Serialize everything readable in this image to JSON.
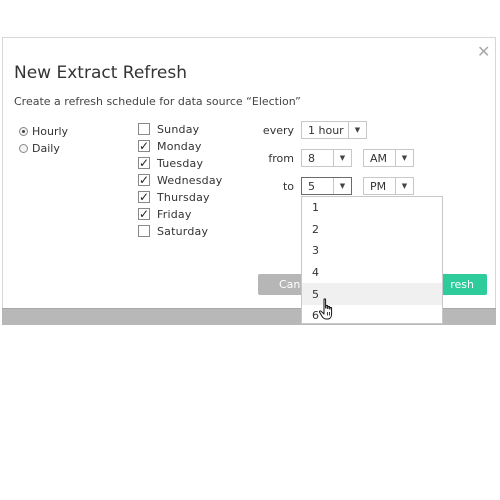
{
  "dialog": {
    "title": "New Extract Refresh",
    "subtitle": "Create a refresh schedule for data source “Election”",
    "close_icon": "✕"
  },
  "frequency": {
    "options": [
      {
        "label": "Hourly",
        "checked": true
      },
      {
        "label": "Daily",
        "checked": false
      }
    ]
  },
  "days": [
    {
      "label": "Sunday",
      "checked": false
    },
    {
      "label": "Monday",
      "checked": true
    },
    {
      "label": "Tuesday",
      "checked": true
    },
    {
      "label": "Wednesday",
      "checked": true
    },
    {
      "label": "Thursday",
      "checked": true
    },
    {
      "label": "Friday",
      "checked": true
    },
    {
      "label": "Saturday",
      "checked": false
    }
  ],
  "schedule": {
    "every_label": "every",
    "every_value": "1 hour",
    "from_label": "from",
    "from_hour": "8",
    "from_ampm": "AM",
    "to_label": "to",
    "to_hour": "5",
    "to_ampm": "PM"
  },
  "dropdown": {
    "items": [
      "1",
      "2",
      "3",
      "4",
      "5",
      "6"
    ],
    "hovered_item": "5"
  },
  "buttons": {
    "cancel_label": "Can",
    "submit_label": "resh"
  },
  "icons": {
    "check": "✓",
    "dropdown_arrow": "▼",
    "cursor": "hand-pointer-icon"
  },
  "colors": {
    "submit_button": "#2ecc9a",
    "cancel_button": "#b6b6b6",
    "bottom_bar": "#b8b8b8"
  }
}
